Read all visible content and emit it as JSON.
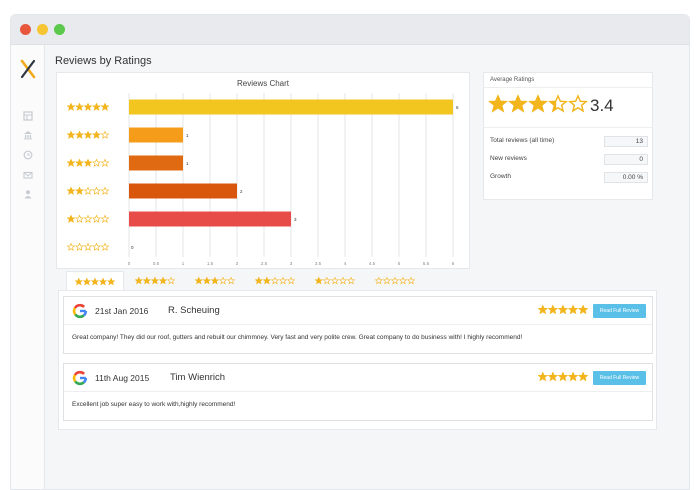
{
  "window": {
    "controls": [
      {
        "name": "close",
        "color": "#e8573c"
      },
      {
        "name": "minimize",
        "color": "#f6c531"
      },
      {
        "name": "maximize",
        "color": "#5cc84c"
      }
    ]
  },
  "sidebar": {
    "logo": "X",
    "items": [
      {
        "icon": "dashboard-icon"
      },
      {
        "icon": "bank-icon"
      },
      {
        "icon": "history-icon"
      },
      {
        "icon": "mail-icon"
      },
      {
        "icon": "user-icon"
      }
    ]
  },
  "page": {
    "title": "Reviews by Ratings"
  },
  "colors": {
    "star": "#f3b51d",
    "star_empty_stroke": "#f3b51d",
    "button": "#5bc0e8"
  },
  "chart_data": {
    "type": "bar",
    "orientation": "horizontal",
    "title": "Reviews Chart",
    "categories": [
      "5 stars",
      "4 stars",
      "3 stars",
      "2 stars",
      "1 star",
      "0 stars"
    ],
    "star_counts": [
      5,
      4,
      3,
      2,
      1,
      0
    ],
    "values": [
      6,
      1,
      1,
      2,
      3,
      0
    ],
    "bar_colors": [
      "#f2c61f",
      "#f59c1b",
      "#e06a12",
      "#d9570d",
      "#e84c48",
      "#dddddd"
    ],
    "xlim": [
      0,
      6
    ],
    "xticks": [
      "0",
      "0.5",
      "1",
      "1.5",
      "2",
      "2.5",
      "3",
      "3.5",
      "4",
      "4.5",
      "5",
      "5.5",
      "6"
    ],
    "grid": true
  },
  "average": {
    "heading": "Average Ratings",
    "value": "3.4",
    "stars_filled": 3.4,
    "stats": [
      {
        "label": "Total reviews (all time)",
        "value": "13"
      },
      {
        "label": "New reviews",
        "value": "0"
      },
      {
        "label": "Growth",
        "value": "0.00 %"
      }
    ]
  },
  "tabs": [
    {
      "stars": 5,
      "active": true
    },
    {
      "stars": 4,
      "active": false
    },
    {
      "stars": 3,
      "active": false
    },
    {
      "stars": 2,
      "active": false
    },
    {
      "stars": 1,
      "active": false
    },
    {
      "stars": 0,
      "active": false
    }
  ],
  "reviews": [
    {
      "date": "21st Jan 2016",
      "author": "R. Scheuing",
      "stars": 5,
      "button": "Read Full Review",
      "text": "Great company! They did our roof, gutters and rebuilt our chimmney. Very fast and very polite crew. Great company to do business with! I highly recommend!"
    },
    {
      "date": "11th Aug 2015",
      "author": "Tim Wienrich",
      "stars": 5,
      "button": "Read Full Review",
      "text": "Excellent job super easy to work with,highly recommend!"
    }
  ]
}
